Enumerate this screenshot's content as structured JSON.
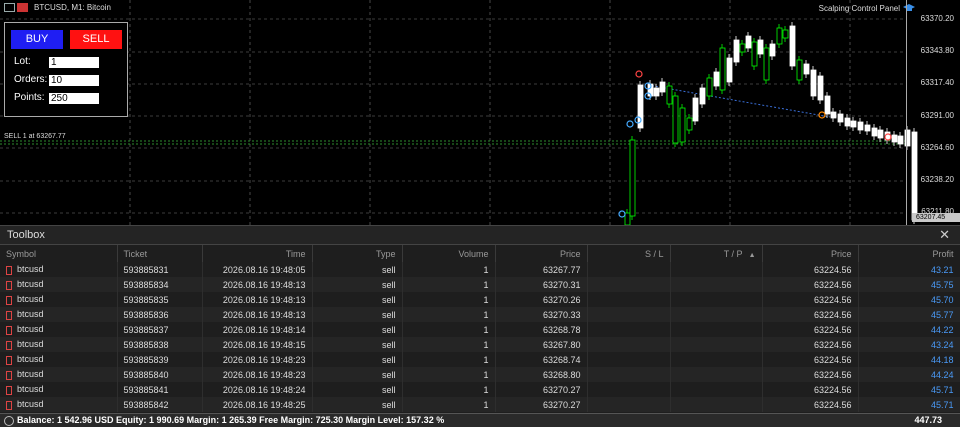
{
  "chart": {
    "symbol_title": "BTCUSD, M1:  Bitcoin",
    "panel_title": "Scalping Control Panel",
    "sell_line_label": "SELL 1 at 63267.77",
    "price_ticks": [
      "63370.20",
      "63343.80",
      "63317.40",
      "63291.00",
      "63264.60",
      "63238.20",
      "63211.80"
    ],
    "current_price_tag": "63207.45"
  },
  "control_panel": {
    "buy_label": "BUY",
    "sell_label": "SELL",
    "lot_label": "Lot:",
    "lot_value": "1",
    "orders_label": "Orders:",
    "orders_value": "10",
    "points_label": "Points:",
    "points_value": "250"
  },
  "toolbox": {
    "title": "Toolbox",
    "close": "✕",
    "columns": [
      "Symbol",
      "Ticket",
      "Time",
      "Type",
      "Volume",
      "Price",
      "S / L",
      "T / P",
      "Price",
      "Profit"
    ],
    "sort_marker": "▲",
    "rows": [
      [
        "btcusd",
        "593885831",
        "2026.08.16 19:48:05",
        "sell",
        "1",
        "63267.77",
        "",
        "",
        "63224.56",
        "43.21"
      ],
      [
        "btcusd",
        "593885834",
        "2026.08.16 19:48:13",
        "sell",
        "1",
        "63270.31",
        "",
        "",
        "63224.56",
        "45.75"
      ],
      [
        "btcusd",
        "593885835",
        "2026.08.16 19:48:13",
        "sell",
        "1",
        "63270.26",
        "",
        "",
        "63224.56",
        "45.70"
      ],
      [
        "btcusd",
        "593885836",
        "2026.08.16 19:48:13",
        "sell",
        "1",
        "63270.33",
        "",
        "",
        "63224.56",
        "45.77"
      ],
      [
        "btcusd",
        "593885837",
        "2026.08.16 19:48:14",
        "sell",
        "1",
        "63268.78",
        "",
        "",
        "63224.56",
        "44.22"
      ],
      [
        "btcusd",
        "593885838",
        "2026.08.16 19:48:15",
        "sell",
        "1",
        "63267.80",
        "",
        "",
        "63224.56",
        "43.24"
      ],
      [
        "btcusd",
        "593885839",
        "2026.08.16 19:48:23",
        "sell",
        "1",
        "63268.74",
        "",
        "",
        "63224.56",
        "44.18"
      ],
      [
        "btcusd",
        "593885840",
        "2026.08.16 19:48:23",
        "sell",
        "1",
        "63268.80",
        "",
        "",
        "63224.56",
        "44.24"
      ],
      [
        "btcusd",
        "593885841",
        "2026.08.16 19:48:24",
        "sell",
        "1",
        "63270.27",
        "",
        "",
        "63224.56",
        "45.71"
      ],
      [
        "btcusd",
        "593885842",
        "2026.08.16 19:48:25",
        "sell",
        "1",
        "63270.27",
        "",
        "",
        "63224.56",
        "45.71"
      ]
    ]
  },
  "status_bar": {
    "text": "Balance: 1 542.96 USD  Equity: 1 990.69  Margin: 1 265.39  Free Margin: 725.30  Margin Level: 157.32 %",
    "total_profit": "447.73"
  },
  "colors": {
    "buy": "#1f1ef3",
    "sell": "#ff1111",
    "bull_candle": "#ffffff",
    "bear_candle": "#00ff00",
    "profit": "#4a9af7"
  }
}
